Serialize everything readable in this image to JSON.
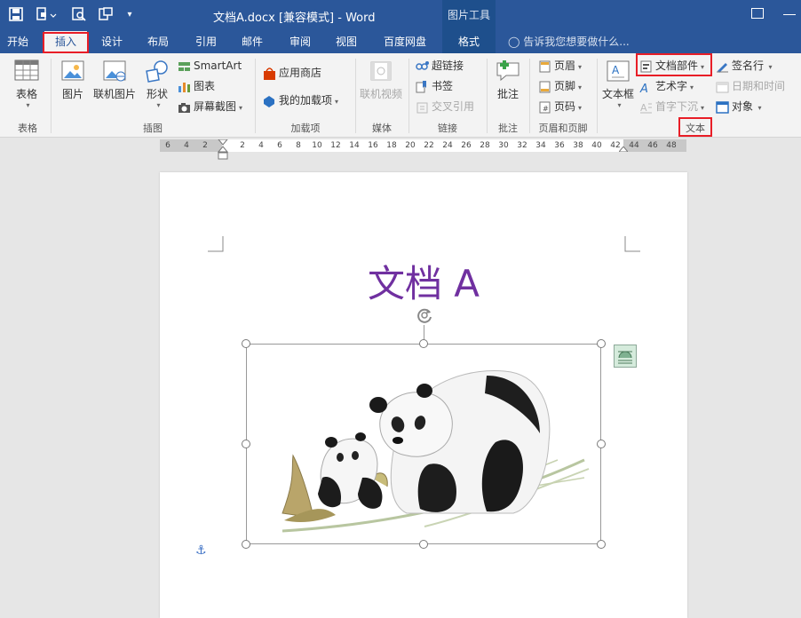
{
  "window": {
    "title": "文档A.docx [兼容模式] - Word",
    "context_tab_group": "图片工具"
  },
  "tabs": [
    {
      "label": "开始"
    },
    {
      "label": "插入",
      "active": true
    },
    {
      "label": "设计"
    },
    {
      "label": "布局"
    },
    {
      "label": "引用"
    },
    {
      "label": "邮件"
    },
    {
      "label": "审阅"
    },
    {
      "label": "视图"
    },
    {
      "label": "百度网盘"
    },
    {
      "label": "格式",
      "contextual": true
    }
  ],
  "tell_me": "告诉我您想要做什么...",
  "ribbon": {
    "table": {
      "btn": "表格",
      "group": "表格"
    },
    "illustrations": {
      "picture": "图片",
      "online_picture": "联机图片",
      "shapes": "形状",
      "smartart": "SmartArt",
      "chart": "图表",
      "screenshot": "屏幕截图",
      "group": "插图"
    },
    "addins": {
      "store": "应用商店",
      "my_addins": "我的加载项",
      "group": "加载项"
    },
    "media": {
      "online_video": "联机视频",
      "group": "媒体"
    },
    "links": {
      "hyperlink": "超链接",
      "bookmark": "书签",
      "cross_ref": "交叉引用",
      "group": "链接"
    },
    "comments": {
      "comment": "批注",
      "group": "批注"
    },
    "header_footer": {
      "header": "页眉",
      "footer": "页脚",
      "page_number": "页码",
      "group": "页眉和页脚"
    },
    "text": {
      "textbox": "文本框",
      "quick_parts": "文档部件",
      "wordart": "艺术字",
      "drop_cap": "首字下沉",
      "signature_line": "签名行",
      "date_time": "日期和时间",
      "object": "对象",
      "group": "文本"
    }
  },
  "ruler": {
    "left_numbers": [
      "6",
      "4",
      "2"
    ],
    "right_numbers": [
      "2",
      "4",
      "6",
      "8",
      "10",
      "12",
      "14",
      "16",
      "18",
      "20",
      "22",
      "24",
      "26",
      "28",
      "30",
      "32",
      "34",
      "36",
      "38",
      "40",
      "42",
      "44",
      "46",
      "48"
    ]
  },
  "document": {
    "heading": "文档 A"
  },
  "colors": {
    "title_bar": "#2b579a",
    "heading": "#7030a0",
    "highlight": "#e81e27"
  }
}
